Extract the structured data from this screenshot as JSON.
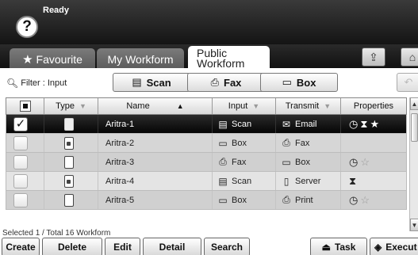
{
  "status": {
    "text": "Ready",
    "help_label": "?"
  },
  "tabs": {
    "favourite": "Favourite",
    "my_workform": "My Workform",
    "public_line1": "Public",
    "public_line2": "Workform"
  },
  "filter": {
    "label": "Filter : Input",
    "buttons": {
      "scan": "Scan",
      "fax": "Fax",
      "box": "Box"
    }
  },
  "table": {
    "columns": {
      "type": "Type",
      "name": "Name",
      "input": "Input",
      "transmit": "Transmit",
      "properties": "Properties"
    },
    "rows": [
      {
        "name": "Aritra-1",
        "input": "Scan",
        "transmit": "Email"
      },
      {
        "name": "Aritra-2",
        "input": "Box",
        "transmit": "Fax"
      },
      {
        "name": "Aritra-3",
        "input": "Fax",
        "transmit": "Box"
      },
      {
        "name": "Aritra-4",
        "input": "Scan",
        "transmit": "Server"
      },
      {
        "name": "Aritra-5",
        "input": "Box",
        "transmit": "Print"
      }
    ]
  },
  "footer": {
    "selection_text": "Selected 1 / Total 16 Workform",
    "buttons": {
      "create": "Create",
      "delete": "Delete",
      "edit": "Edit",
      "detail": "Detail",
      "search": "Search",
      "task": "Task",
      "execute": "Execut"
    }
  }
}
